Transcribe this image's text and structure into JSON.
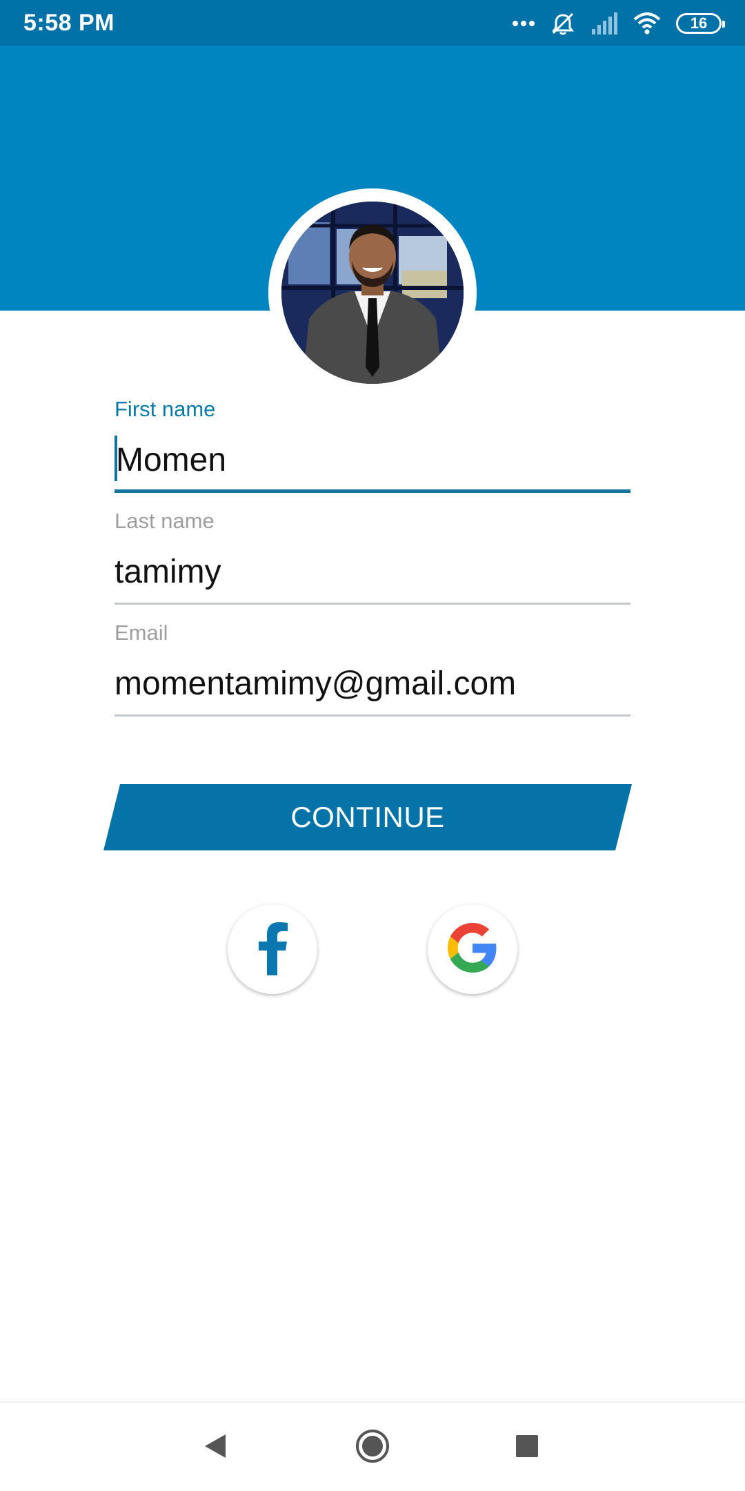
{
  "status_bar": {
    "time": "5:58 PM",
    "battery_level": "16",
    "icons": [
      "more-dots-icon",
      "alarm-off-icon",
      "signal-icon",
      "wifi-icon",
      "battery-icon"
    ]
  },
  "profile": {
    "avatar_icon": "profile-photo"
  },
  "form": {
    "first_name": {
      "label": "First name",
      "value": "Momen"
    },
    "last_name": {
      "label": "Last name",
      "value": "tamimy"
    },
    "email": {
      "label": "Email",
      "value": "momentamimy@gmail.com"
    },
    "continue_label": "CONTINUE"
  },
  "social": {
    "facebook_icon": "facebook-icon",
    "google_icon": "google-icon"
  },
  "nav": {
    "back_icon": "back-icon",
    "home_icon": "home-icon",
    "recents_icon": "recents-icon"
  },
  "colors": {
    "primary": "#0085c0",
    "status_bar": "#0072a8",
    "button": "#0573a8",
    "active_label": "#0a7aa8"
  }
}
